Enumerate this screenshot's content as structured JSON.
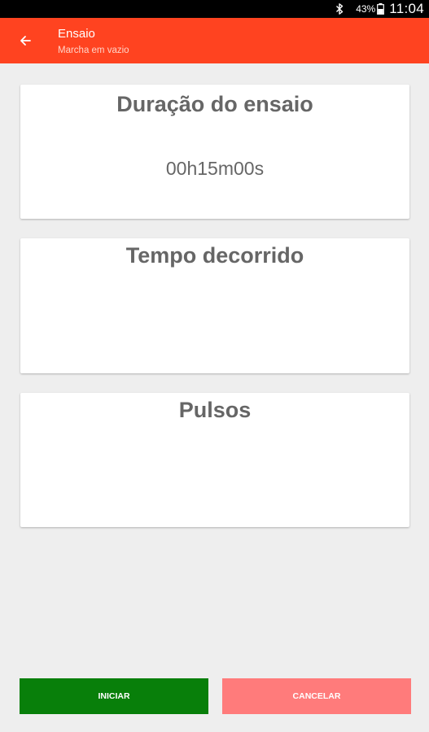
{
  "status_bar": {
    "battery_percent": "43%",
    "time": "11:04",
    "icons": [
      "bluetooth-icon",
      "battery-icon"
    ]
  },
  "app_bar": {
    "title": "Ensaio",
    "subtitle": "Marcha em vazio",
    "back_icon": "arrow-left-icon",
    "background_color": "#ff4320"
  },
  "cards": {
    "duration": {
      "heading": "Duração do ensaio",
      "value": "00h15m00s"
    },
    "elapsed": {
      "heading": "Tempo decorrido",
      "value": ""
    },
    "pulses": {
      "heading": "Pulsos",
      "value": ""
    }
  },
  "actions": {
    "start_label": "INICIAR",
    "cancel_label": "CANCELAR",
    "start_color": "#087f0a",
    "cancel_color": "#ff7b7b"
  }
}
